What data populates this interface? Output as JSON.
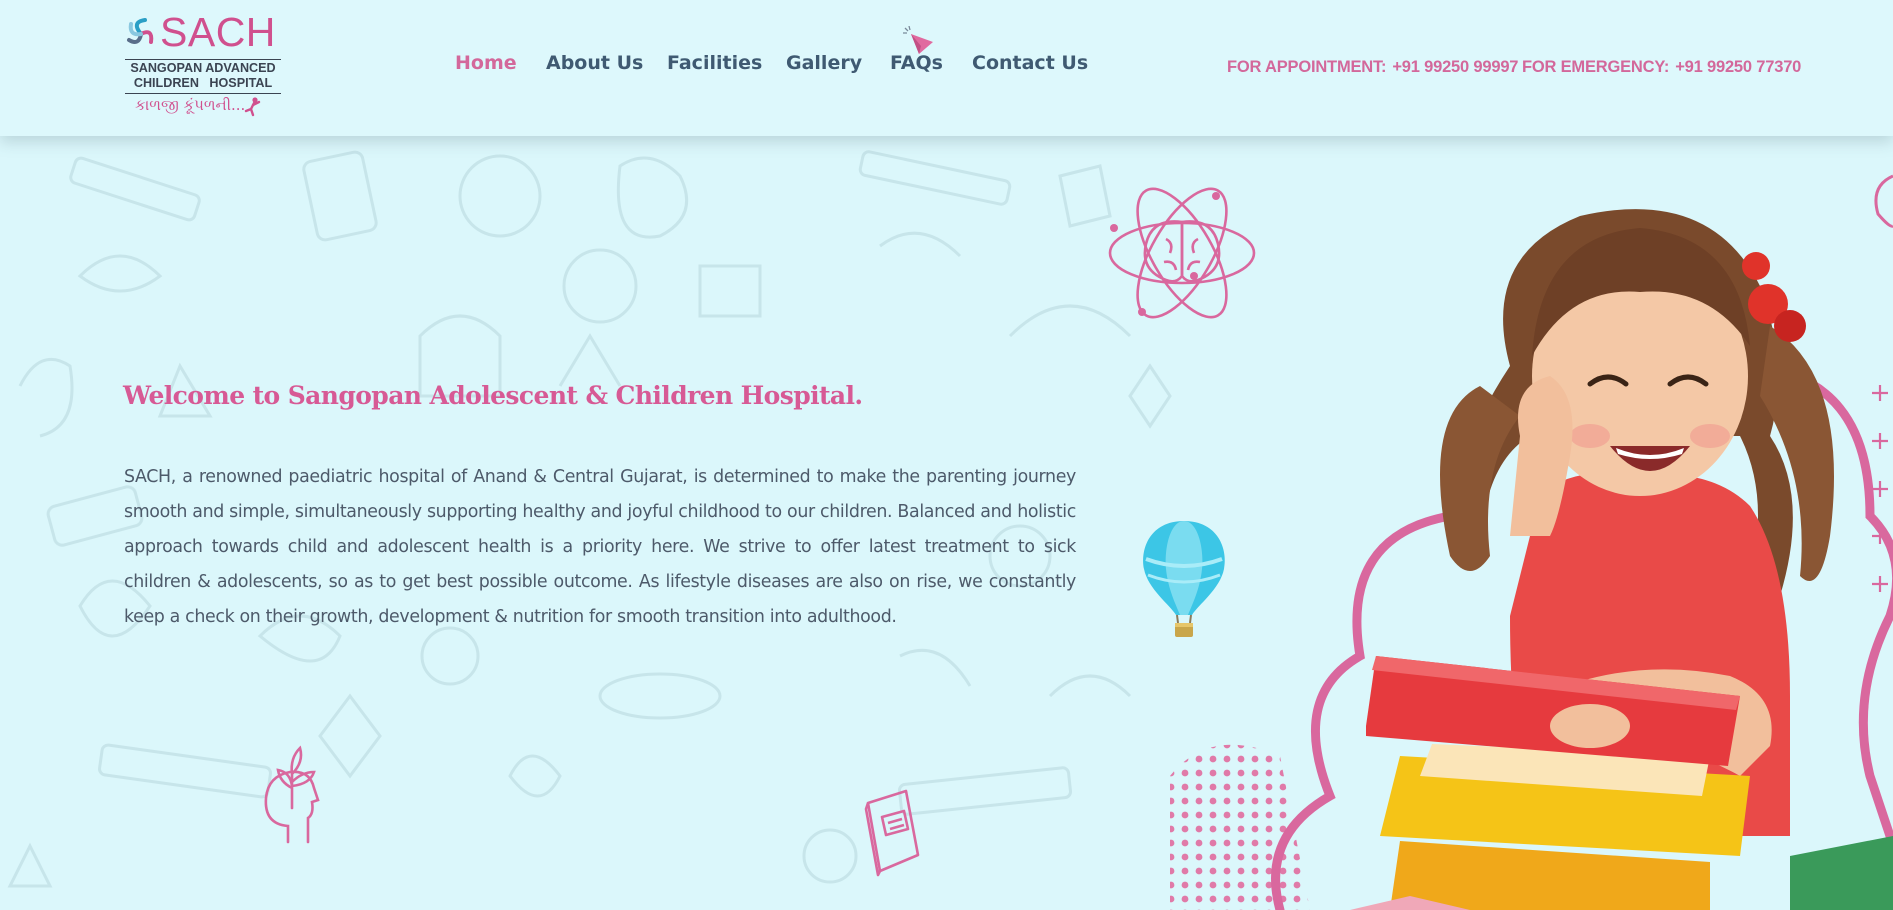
{
  "logo": {
    "word": "SACH",
    "sub_line1": "SANGOPAN ADVANCED",
    "sub_line2": "CHILDREN   HOSPITAL",
    "tagline": "કાળજી કૂંપળની..."
  },
  "nav": {
    "items": [
      {
        "label": "Home",
        "active": true
      },
      {
        "label": "About Us",
        "active": false
      },
      {
        "label": "Facilities",
        "active": false
      },
      {
        "label": "Gallery",
        "active": false
      },
      {
        "label": "FAQs",
        "active": false
      },
      {
        "label": "Contact Us",
        "active": false
      }
    ]
  },
  "contact": {
    "appointment_label": "FOR APPOINTMENT:",
    "appointment_phone": "+91 99250 99997",
    "emergency_label": "FOR EMERGENCY:",
    "emergency_phone": "+91 99250 77370"
  },
  "hero": {
    "title": "Welcome to Sangopan Adolescent & Children Hospital.",
    "body": "SACH, a renowned paediatric hospital of Anand & Central Gujarat, is determined to make the parenting journey smooth and simple, simultaneously supporting healthy and joyful childhood to our children. Balanced and holistic approach towards child and adolescent health is a priority here. We strive to offer latest treatment to sick children & adolescents, so as to get best possible outcome. As lifestyle diseases are also on rise, we constantly keep a check on their growth, development & nutrition for smooth transition into adulthood."
  },
  "colors": {
    "background": "#dbf7fb",
    "brand_pink": "#d3689b",
    "nav_text": "#3f5a72",
    "body_text": "#4d5a6a"
  },
  "icons": [
    "logo-swirl-icon",
    "paper-plane-icon",
    "brain-atom-icon",
    "hot-air-balloon-icon",
    "plant-head-icon",
    "book-icon"
  ]
}
